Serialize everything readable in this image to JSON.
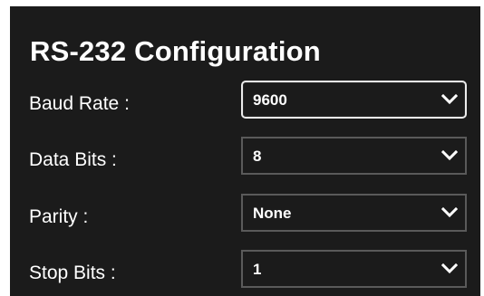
{
  "panel": {
    "title": "RS-232 Configuration"
  },
  "fields": [
    {
      "label": "Baud Rate :",
      "value": "9600",
      "focused": true
    },
    {
      "label": "Data Bits :",
      "value": "8",
      "focused": false
    },
    {
      "label": "Parity :",
      "value": "None",
      "focused": false
    },
    {
      "label": "Stop Bits :",
      "value": "1",
      "focused": false
    }
  ],
  "icons": {
    "dropdown": "chevron-down-icon"
  },
  "colors": {
    "panel_background": "#1b1b1b",
    "text": "#ffffff",
    "select_border": "#5a5a5a",
    "select_border_focused": "#ececec"
  }
}
